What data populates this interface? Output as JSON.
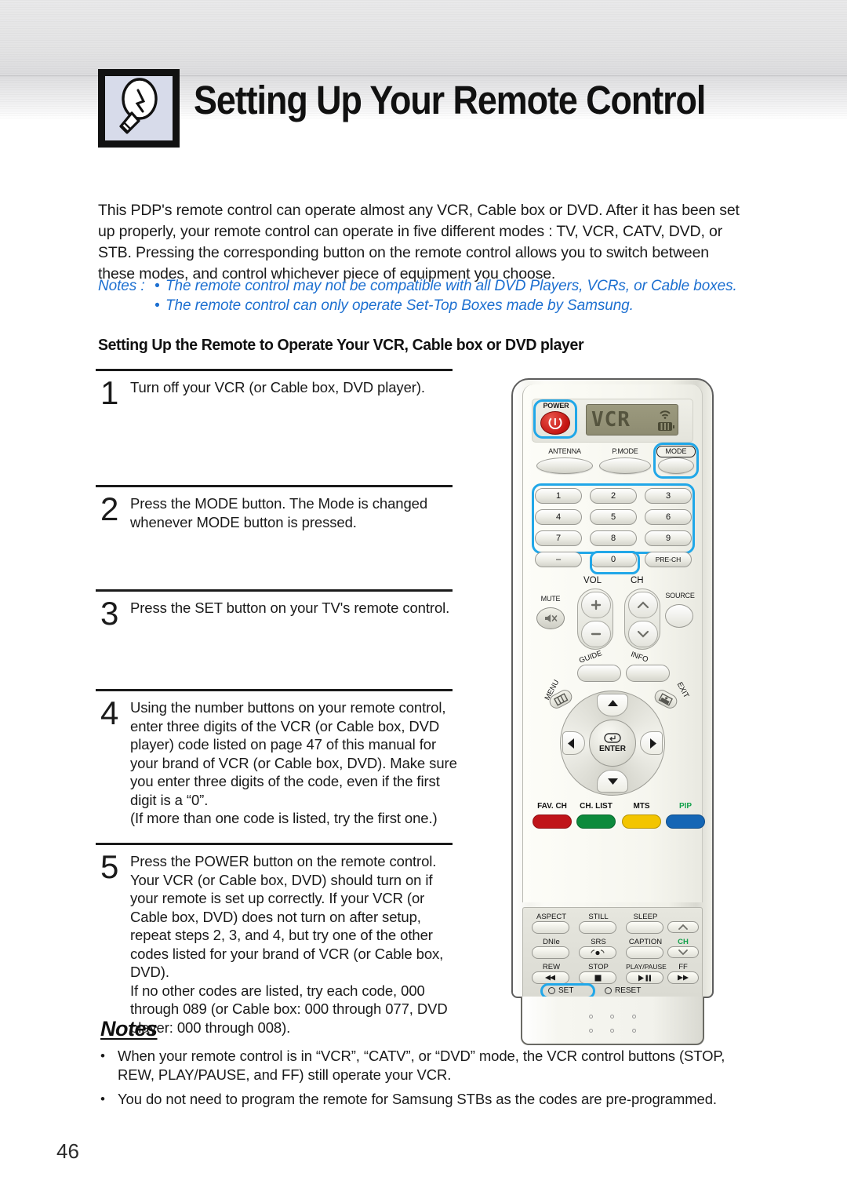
{
  "header": {
    "title": "Setting Up Your Remote Control",
    "icon": "lightbulb-icon"
  },
  "intro": {
    "paragraph": "This PDP's remote control can operate almost any VCR, Cable box or DVD. After it has been set up properly, your remote control can operate in five different modes : TV, VCR, CATV, DVD, or STB. Pressing the corresponding button on the remote control allows you to switch between these modes, and control whichever piece of equipment you choose."
  },
  "top_notes": {
    "lead": "Notes :",
    "bullet": "•",
    "items": [
      "The remote control may not be compatible with all DVD Players, VCRs, or Cable boxes.",
      "The remote control can only operate Set-Top Boxes made by Samsung."
    ],
    "color": "#1c6fd0"
  },
  "section_heading": "Setting Up the Remote to Operate Your VCR, Cable box or DVD player",
  "steps": [
    {
      "number": "1",
      "text": "Turn off your VCR (or Cable box, DVD player)."
    },
    {
      "number": "2",
      "text": "Press the MODE button. The Mode is changed whenever MODE button is pressed."
    },
    {
      "number": "3",
      "text": "Press the SET button on your TV's remote control."
    },
    {
      "number": "4",
      "text": "Using the number buttons on your remote control, enter three digits of the VCR (or Cable box, DVD player) code listed on page 47 of this manual for your brand of VCR (or Cable box, DVD). Make sure you enter three digits of the code, even if the first digit is a “0”.\n(If more than one code is listed, try the first one.)"
    },
    {
      "number": "5",
      "text": "Press the POWER button on the remote control. Your VCR (or Cable box, DVD) should turn on if your remote is set up correctly. If your VCR (or Cable box, DVD) does not turn on after setup, repeat steps 2, 3, and 4, but try one of the other codes listed for your brand of VCR (or Cable box, DVD).\nIf no other codes are listed, try each code, 000 through 089 (or Cable box: 000 through 077, DVD player: 000 through 008)."
    }
  ],
  "bottom_notes": {
    "title": "Notes",
    "bullet": "•",
    "items": [
      "When your remote control is in “VCR”, “CATV”, or “DVD” mode, the VCR control buttons (STOP, REW, PLAY/PAUSE, and FF) still operate your VCR.",
      "You do not need to program the remote for Samsung STBs as the codes are pre-programmed."
    ]
  },
  "page_number": "46",
  "remote": {
    "power_label": "POWER",
    "lcd_text": "VCR",
    "row_mode": {
      "antenna": "ANTENNA",
      "pmode": "P.MODE",
      "mode": "MODE"
    },
    "keypad": [
      "1",
      "2",
      "3",
      "4",
      "5",
      "6",
      "7",
      "8",
      "9",
      "–",
      "0",
      "PRE-CH"
    ],
    "vol_label": "VOL",
    "ch_label": "CH",
    "mute_label": "MUTE",
    "source_label": "SOURCE",
    "guide_label": "GUIDE",
    "info_label": "INFO",
    "menu_label": "MENU",
    "exit_label": "EXIT",
    "enter_label": "ENTER",
    "color_buttons": [
      {
        "label": "FAV. CH",
        "color": "#c0141a",
        "label_color": "#111111"
      },
      {
        "label": "CH. LIST",
        "color": "#0c8a3c",
        "label_color": "#111111"
      },
      {
        "label": "MTS",
        "color": "#f3c500",
        "label_color": "#111111"
      },
      {
        "label": "PIP",
        "color": "#1566b5",
        "label_color": "#12a14b"
      }
    ],
    "lower_panel": {
      "row1": [
        "ASPECT",
        "STILL",
        "SLEEP"
      ],
      "row2": [
        "DNIe",
        "SRS",
        "CAPTION"
      ],
      "row3": [
        "REW",
        "STOP",
        "PLAY/PAUSE",
        "FF"
      ],
      "ch_label": "CH",
      "set_label": "SET",
      "reset_label": "RESET"
    },
    "highlight_color": "#21a7e8"
  }
}
